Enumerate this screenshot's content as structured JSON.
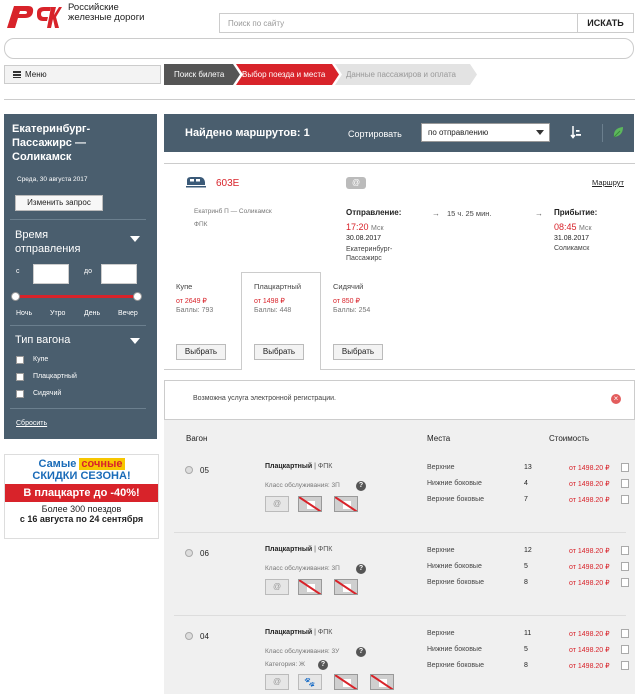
{
  "header": {
    "brand_line1": "Российские",
    "brand_line2": "железные дороги",
    "search_placeholder": "Поиск по сайту",
    "search_button": "ИСКАТЬ",
    "menu_label": "Меню"
  },
  "steps": [
    "Поиск билета",
    "Выбор поезда и места",
    "Данные пассажиров и оплата"
  ],
  "sidebar": {
    "route_line1": "Екатеринбург-",
    "route_line2": "Пассажирс —",
    "route_line3": "Соликамск",
    "date": "Среда, 30 августа 2017",
    "change_button": "Изменить запрос",
    "time_title_line1": "Время",
    "time_title_line2": "отправления",
    "from_label": "с",
    "to_label": "до",
    "slider_labels": [
      "Ночь",
      "Утро",
      "День",
      "Вечер"
    ],
    "car_type_title": "Тип вагона",
    "car_types": [
      "Купе",
      "Плацкартный",
      "Сидячий"
    ],
    "reset": "Сбросить"
  },
  "banner": {
    "line1a": "Самые",
    "line1b": "сочные",
    "line2": "СКИДКИ СЕЗОНА!",
    "line3": "В плацкарте до -40%!",
    "line4": "Более 300 поездов",
    "line5": "с 16 августа по 24 сентября"
  },
  "results": {
    "found": "Найдено маршрутов: 1",
    "sort_label": "Сортировать",
    "sort_value": "по отправлению"
  },
  "train": {
    "number": "603Е",
    "route_link": "Маршрут",
    "route": "Екатринб П — Соликамск",
    "carrier": "ФПК",
    "depart_label": "Отправление:",
    "depart_time": "17:20",
    "depart_tz": "Мск",
    "depart_date": "30.08.2017",
    "depart_station1": "Екатеринбург-",
    "depart_station2": "Пассажирс",
    "duration": "15 ч. 25 мин.",
    "arrive_label": "Прибытие:",
    "arrive_time": "08:45",
    "arrive_tz": "Мск",
    "arrive_date": "31.08.2017",
    "arrive_station": "Соликамск",
    "classes": [
      {
        "name": "Купе",
        "price": "от 2649 ₽",
        "points": "Баллы: 793",
        "button": "Выбрать"
      },
      {
        "name": "Плацкартный",
        "price": "от 1498 ₽",
        "points": "Баллы: 448",
        "button": "Выбрать"
      },
      {
        "name": "Сидячий",
        "price": "от 850 ₽",
        "points": "Баллы: 254",
        "button": "Выбрать"
      }
    ]
  },
  "notice": "Возможна услуга электронной регистрации.",
  "wagons_header": {
    "car": "Вагон",
    "seats": "Места",
    "cost": "Стоимость"
  },
  "wagons": [
    {
      "number": "05",
      "type": "Плацкартный",
      "carrier": "| ФПК",
      "service": "Класс обслуживания: 3П",
      "category": "",
      "seats": [
        {
          "kind": "Верхние",
          "count": "13",
          "price": "от 1498.20 ₽"
        },
        {
          "kind": "Нижние боковые",
          "count": "4",
          "price": "от 1498.20 ₽"
        },
        {
          "kind": "Верхние боковые",
          "count": "7",
          "price": "от 1498.20 ₽"
        }
      ]
    },
    {
      "number": "06",
      "type": "Плацкартный",
      "carrier": "| ФПК",
      "service": "Класс обслуживания: 3П",
      "category": "",
      "seats": [
        {
          "kind": "Верхние",
          "count": "12",
          "price": "от 1498.20 ₽"
        },
        {
          "kind": "Нижние боковые",
          "count": "5",
          "price": "от 1498.20 ₽"
        },
        {
          "kind": "Верхние боковые",
          "count": "8",
          "price": "от 1498.20 ₽"
        }
      ]
    },
    {
      "number": "04",
      "type": "Плацкартный",
      "carrier": "| ФПК",
      "service": "Класс обслуживания: 3У",
      "category": "Категория: Ж",
      "seats": [
        {
          "kind": "Верхние",
          "count": "11",
          "price": "от 1498.20 ₽"
        },
        {
          "kind": "Нижние боковые",
          "count": "5",
          "price": "от 1498.20 ₽"
        },
        {
          "kind": "Верхние боковые",
          "count": "8",
          "price": "от 1498.20 ₽"
        }
      ]
    }
  ],
  "colors": {
    "brand_red": "#d8232a",
    "panel": "#4a5e6e",
    "step_active": "#d8232a",
    "step_done": "#555555",
    "step_next": "#e3e3e3"
  }
}
